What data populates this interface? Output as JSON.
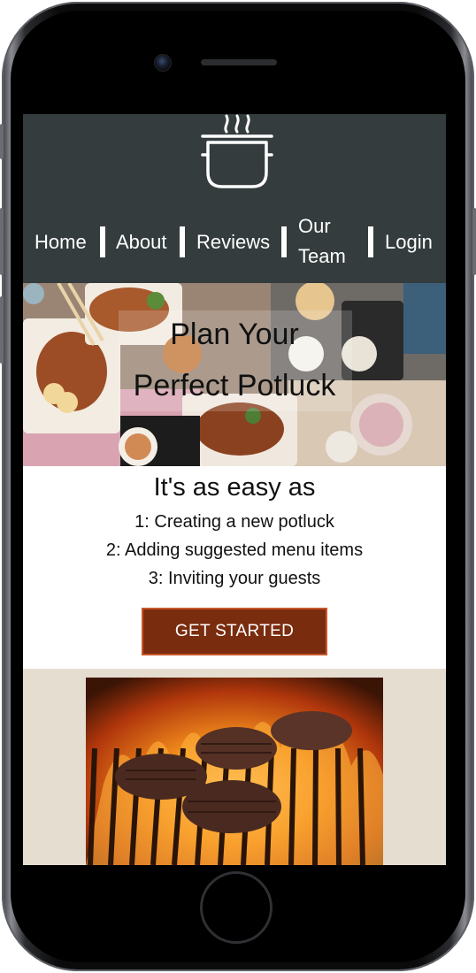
{
  "app": {
    "logo_icon": "cooking-pot-icon",
    "header_color": "#343c3d"
  },
  "nav": {
    "home": "Home",
    "about": "About",
    "reviews": "Reviews",
    "our_team_line1": "Our",
    "our_team_line2": "Team",
    "login": "Login"
  },
  "hero": {
    "line1": "Plan Your",
    "line2": "Perfect Potluck"
  },
  "steps": {
    "heading": "It's as easy as",
    "items": [
      "1: Creating a new potluck",
      "2: Adding suggested menu items",
      "3: Inviting your guests"
    ],
    "cta_label": "GET STARTED",
    "cta_color": "#7a2c0f"
  },
  "grill": {
    "section_bg": "#e5ddcf"
  }
}
